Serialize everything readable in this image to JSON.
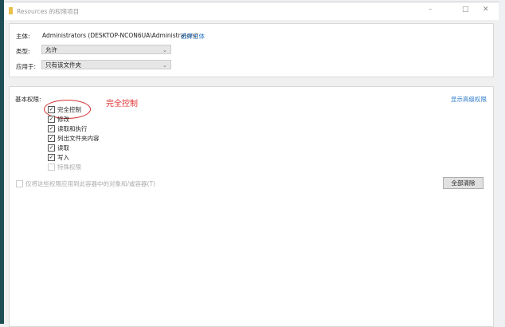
{
  "window": {
    "title": "Resources 的权限项目",
    "minimize": "–",
    "maximize": "□",
    "close": "✕"
  },
  "principal": {
    "label": "主体:",
    "value": "Administrators (DESKTOP-NCON6UA\\Administrators)",
    "link": "选择主体"
  },
  "type": {
    "label": "类型:",
    "value": "允许"
  },
  "applies_to": {
    "label": "应用于:",
    "value": "只有该文件夹"
  },
  "basic": {
    "label": "基本权限:",
    "show_advanced": "显示高级权限",
    "items": [
      {
        "label": "完全控制",
        "checked": true
      },
      {
        "label": "修改",
        "checked": true
      },
      {
        "label": "读取和执行",
        "checked": true
      },
      {
        "label": "列出文件夹内容",
        "checked": true
      },
      {
        "label": "读取",
        "checked": true
      },
      {
        "label": "写入",
        "checked": true
      },
      {
        "label": "特殊权限",
        "checked": false
      }
    ],
    "apply_only": "仅将这些权限应用到此容器中的对象和/或容器(T)",
    "clear_all": "全部清除",
    "annotation": "完全控制"
  },
  "colors": {
    "link": "#2a78c8",
    "annotation": "#e03030"
  }
}
